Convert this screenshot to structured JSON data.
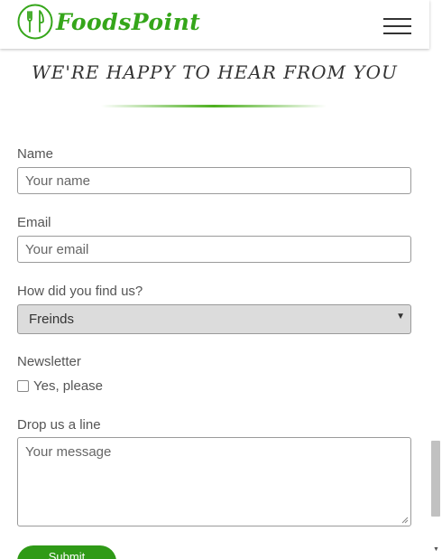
{
  "header": {
    "logo_text": "FoodsPoint",
    "logo_icon": "fork-knife-circle-icon",
    "menu_icon": "hamburger-menu-icon"
  },
  "form": {
    "heading": "WE'RE HAPPY TO HEAR FROM YOU",
    "name": {
      "label": "Name",
      "placeholder": "Your name",
      "value": ""
    },
    "email": {
      "label": "Email",
      "placeholder": "Your email",
      "value": ""
    },
    "source": {
      "label": "How did you find us?",
      "selected": "Freinds"
    },
    "newsletter": {
      "label": "Newsletter",
      "option_label": "Yes, please",
      "checked": false
    },
    "message": {
      "label": "Drop us a line",
      "placeholder": "Your message",
      "value": ""
    },
    "submit_label": "Submit"
  },
  "colors": {
    "brand": "#35a61a",
    "button": "#2f9a17"
  }
}
